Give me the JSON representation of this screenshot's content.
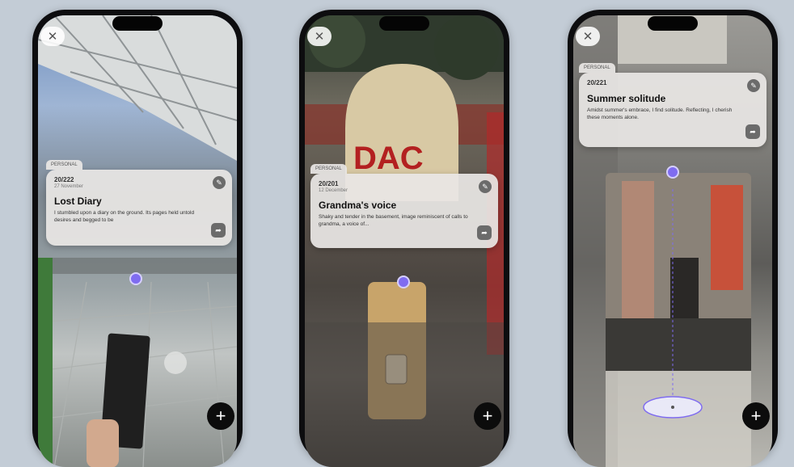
{
  "phones": [
    {
      "card": {
        "tag": "PERSONAL",
        "date": "20/222",
        "sub": "27 November",
        "title": "Lost Diary",
        "body": "I stumbled upon a diary on the ground. Its pages held untold desires and begged to be"
      }
    },
    {
      "card": {
        "tag": "PERSONAL",
        "date": "20/201",
        "sub": "12 December",
        "title": "Grandma's voice",
        "body": "Shaky and tender in the basement, image reminiscent of calls to grandma, a voice of..."
      }
    },
    {
      "card": {
        "tag": "PERSONAL",
        "date": "20/221",
        "sub": "",
        "title": "Summer solitude",
        "body": "Amidst summer's embrace, I find solitude. Reflecting, I cherish these moments alone."
      }
    }
  ],
  "icons": {
    "close": "✕",
    "add": "+",
    "edit": "✎",
    "share": "➦"
  },
  "colors": {
    "background": "#c3ccd6",
    "pin": "#7f6cf0",
    "phone_frame": "#0d0d0f"
  }
}
